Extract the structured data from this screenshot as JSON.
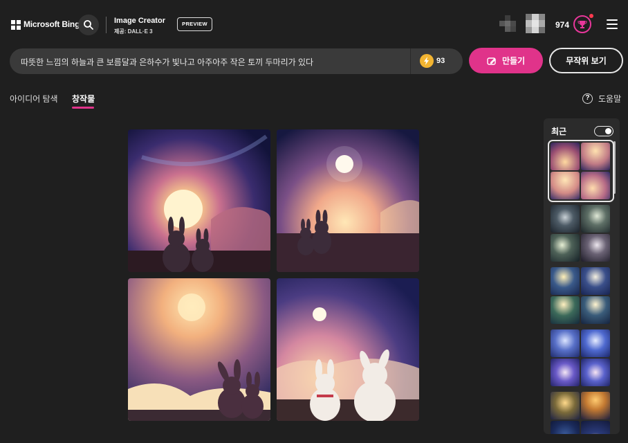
{
  "header": {
    "brand": "Microsoft Bing",
    "app_title": "Image Creator",
    "app_subtitle": "제공: DALL·E 3",
    "preview_badge": "PREVIEW",
    "coin_count": "974"
  },
  "prompt": {
    "text": "따뜻한 느낌의 하늘과 큰 보름달과 은하수가 빛나고 아주아주 작은 토끼 두마리가 있다",
    "boost_count": "93"
  },
  "actions": {
    "create_label": "만들기",
    "surprise_label": "무작위 보기"
  },
  "tabs": [
    {
      "label": "아이디어 탐색",
      "active": false
    },
    {
      "label": "창작물",
      "active": true
    }
  ],
  "help_label": "도움말",
  "sidebar": {
    "title": "최근",
    "toggle_on": true
  },
  "icons": [
    "search-icon",
    "reward-icon",
    "menu-icon",
    "boost-icon",
    "create-icon",
    "help-icon"
  ],
  "colors": {
    "accent": "#e0338a",
    "background": "#1f1f1f",
    "prompt_bg": "#3a3a3a",
    "boost": "#f2b431"
  }
}
